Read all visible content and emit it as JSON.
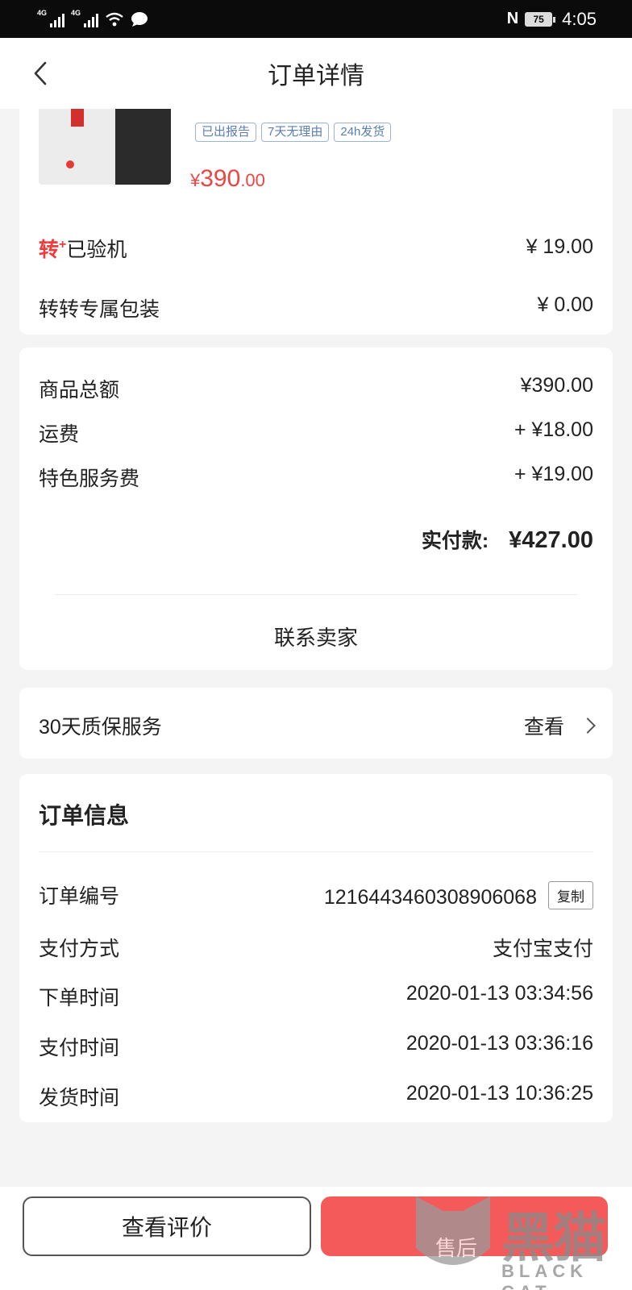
{
  "status_bar": {
    "signal1_gen": "4G",
    "signal2_gen": "4G",
    "battery": "75",
    "time": "4:05",
    "icons": [
      "signal-icon",
      "signal-icon",
      "wifi-icon",
      "chat-bubble-icon",
      "nfc-icon",
      "battery-icon"
    ]
  },
  "header": {
    "title": "订单详情",
    "back_icon": "chevron-left-icon"
  },
  "product": {
    "tags": [
      "已出报告",
      "7天无理由",
      "24h发货"
    ],
    "price_currency": "¥",
    "price_int": "390",
    "price_dec": ".00"
  },
  "services": [
    {
      "brand": "转",
      "brand_sup": "+",
      "label": "已验机",
      "value": "¥ 19.00"
    },
    {
      "label": "转转专属包装",
      "value": "¥ 0.00"
    }
  ],
  "summary": {
    "rows": [
      {
        "label": "商品总额",
        "value": "¥390.00"
      },
      {
        "label": "运费",
        "value": "+ ¥18.00"
      },
      {
        "label": "特色服务费",
        "value": "+ ¥19.00"
      }
    ],
    "total_label": "实付款:",
    "total_value": "¥427.00",
    "contact_seller": "联系卖家"
  },
  "warranty": {
    "label": "30天质保服务",
    "action": "查看"
  },
  "order_info": {
    "title": "订单信息",
    "order_no_label": "订单编号",
    "order_no": "1216443460308906068",
    "copy_label": "复制",
    "rows": [
      {
        "label": "支付方式",
        "value": "支付宝支付"
      },
      {
        "label": "下单时间",
        "value": "2020-01-13 03:34:56"
      },
      {
        "label": "支付时间",
        "value": "2020-01-13 03:36:16"
      },
      {
        "label": "发货时间",
        "value": "2020-01-13 10:36:25"
      }
    ]
  },
  "bottom_bar": {
    "review_label": "查看评价"
  },
  "watermark": {
    "text": "黑猫",
    "sub": "BLACK CAT",
    "store": "售后"
  },
  "colors": {
    "accent_red": "#ee4444",
    "primary_button": "#f45a5a",
    "tag_blue": "#5a7db5"
  }
}
